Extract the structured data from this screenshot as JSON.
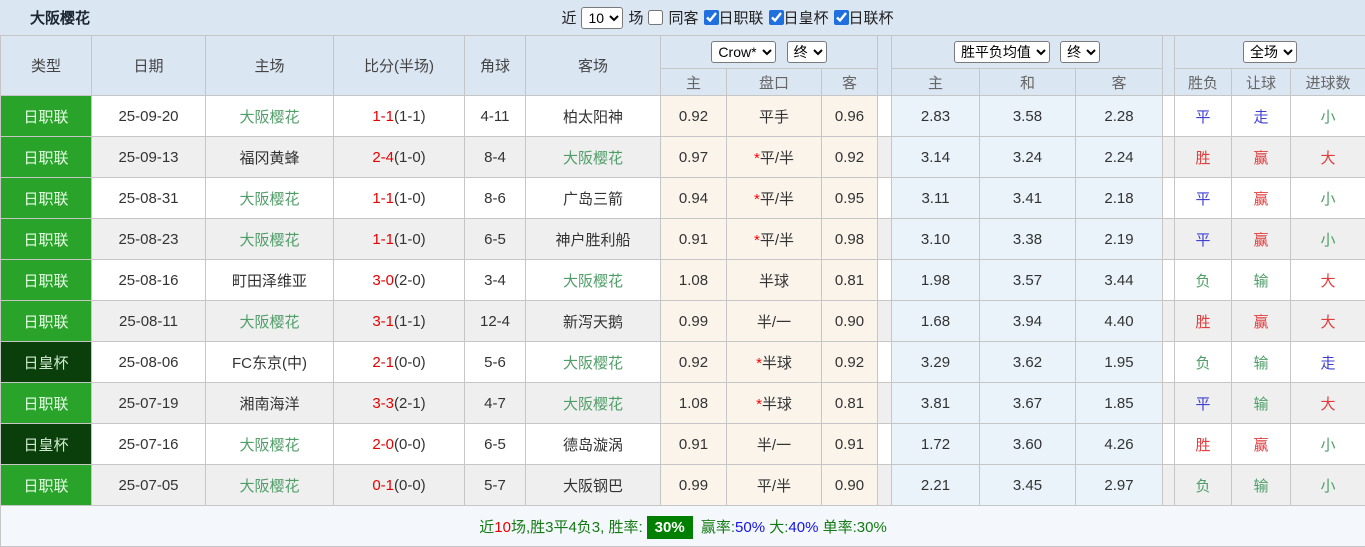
{
  "topbar": {
    "title": "大阪樱花",
    "recent_label": "近",
    "recent_value": "10",
    "matches_label": "场",
    "same_away_label": "同客",
    "same_away_checked": false,
    "filters": [
      {
        "label": "日职联",
        "checked": true
      },
      {
        "label": "日皇杯",
        "checked": true
      },
      {
        "label": "日联杯",
        "checked": true
      }
    ]
  },
  "header": {
    "col_type": "类型",
    "col_date": "日期",
    "col_home": "主场",
    "col_score": "比分(半场)",
    "col_corner": "角球",
    "col_away": "客场",
    "odds_company": "Crow*",
    "odds_state": "终",
    "avg_type": "胜平负均值",
    "avg_state": "终",
    "scope": "全场",
    "sub": {
      "home": "主",
      "handicap": "盘口",
      "away": "客",
      "avg_home": "主",
      "avg_draw": "和",
      "avg_away": "客",
      "result": "胜负",
      "handicap_result": "让球",
      "goals": "进球数"
    }
  },
  "rows": [
    {
      "league": {
        "text": "日职联",
        "c": "j1"
      },
      "date": "25-09-20",
      "home": {
        "text": "大阪樱花",
        "c": "green"
      },
      "score": {
        "ft": "1-1",
        "ht": "(1-1)"
      },
      "corner": "4-11",
      "away": {
        "text": "柏太阳神",
        "c": "dark"
      },
      "odds_home": "0.92",
      "handicap": {
        "star": false,
        "text": "平手"
      },
      "odds_away": "0.96",
      "avg_home": "2.83",
      "avg_draw": "3.58",
      "avg_away": "2.28",
      "result": {
        "text": "平",
        "c": "blue"
      },
      "hresult": {
        "text": "走",
        "c": "blue"
      },
      "goals": {
        "text": "小",
        "c": "green"
      }
    },
    {
      "league": {
        "text": "日职联",
        "c": "j1"
      },
      "date": "25-09-13",
      "home": {
        "text": "福冈黄蜂",
        "c": "dark"
      },
      "score": {
        "ft": "2-4",
        "ht": "(1-0)"
      },
      "corner": "8-4",
      "away": {
        "text": "大阪樱花",
        "c": "green"
      },
      "odds_home": "0.97",
      "handicap": {
        "star": true,
        "text": "平/半"
      },
      "odds_away": "0.92",
      "avg_home": "3.14",
      "avg_draw": "3.24",
      "avg_away": "2.24",
      "result": {
        "text": "胜",
        "c": "red"
      },
      "hresult": {
        "text": "赢",
        "c": "red"
      },
      "goals": {
        "text": "大",
        "c": "red"
      }
    },
    {
      "league": {
        "text": "日职联",
        "c": "j1"
      },
      "date": "25-08-31",
      "home": {
        "text": "大阪樱花",
        "c": "green"
      },
      "score": {
        "ft": "1-1",
        "ht": "(1-0)"
      },
      "corner": "8-6",
      "away": {
        "text": "广岛三箭",
        "c": "dark"
      },
      "odds_home": "0.94",
      "handicap": {
        "star": true,
        "text": "平/半"
      },
      "odds_away": "0.95",
      "avg_home": "3.11",
      "avg_draw": "3.41",
      "avg_away": "2.18",
      "result": {
        "text": "平",
        "c": "blue"
      },
      "hresult": {
        "text": "赢",
        "c": "red"
      },
      "goals": {
        "text": "小",
        "c": "green"
      }
    },
    {
      "league": {
        "text": "日职联",
        "c": "j1"
      },
      "date": "25-08-23",
      "home": {
        "text": "大阪樱花",
        "c": "green"
      },
      "score": {
        "ft": "1-1",
        "ht": "(1-0)"
      },
      "corner": "6-5",
      "away": {
        "text": "神户胜利船",
        "c": "dark"
      },
      "odds_home": "0.91",
      "handicap": {
        "star": true,
        "text": "平/半"
      },
      "odds_away": "0.98",
      "avg_home": "3.10",
      "avg_draw": "3.38",
      "avg_away": "2.19",
      "result": {
        "text": "平",
        "c": "blue"
      },
      "hresult": {
        "text": "赢",
        "c": "red"
      },
      "goals": {
        "text": "小",
        "c": "green"
      }
    },
    {
      "league": {
        "text": "日职联",
        "c": "j1"
      },
      "date": "25-08-16",
      "home": {
        "text": "町田泽维亚",
        "c": "dark"
      },
      "score": {
        "ft": "3-0",
        "ht": "(2-0)"
      },
      "corner": "3-4",
      "away": {
        "text": "大阪樱花",
        "c": "green"
      },
      "odds_home": "1.08",
      "handicap": {
        "star": false,
        "text": "半球"
      },
      "odds_away": "0.81",
      "avg_home": "1.98",
      "avg_draw": "3.57",
      "avg_away": "3.44",
      "result": {
        "text": "负",
        "c": "green"
      },
      "hresult": {
        "text": "输",
        "c": "green"
      },
      "goals": {
        "text": "大",
        "c": "red"
      }
    },
    {
      "league": {
        "text": "日职联",
        "c": "j1"
      },
      "date": "25-08-11",
      "home": {
        "text": "大阪樱花",
        "c": "green"
      },
      "score": {
        "ft": "3-1",
        "ht": "(1-1)"
      },
      "corner": "12-4",
      "away": {
        "text": "新泻天鹅",
        "c": "dark"
      },
      "odds_home": "0.99",
      "handicap": {
        "star": false,
        "text": "半/一"
      },
      "odds_away": "0.90",
      "avg_home": "1.68",
      "avg_draw": "3.94",
      "avg_away": "4.40",
      "result": {
        "text": "胜",
        "c": "red"
      },
      "hresult": {
        "text": "赢",
        "c": "red"
      },
      "goals": {
        "text": "大",
        "c": "red"
      }
    },
    {
      "league": {
        "text": "日皇杯",
        "c": "cup"
      },
      "date": "25-08-06",
      "home": {
        "text": "FC东京(中)",
        "c": "dark"
      },
      "score": {
        "ft": "2-1",
        "ht": "(0-0)"
      },
      "corner": "5-6",
      "away": {
        "text": "大阪樱花",
        "c": "green"
      },
      "odds_home": "0.92",
      "handicap": {
        "star": true,
        "text": "半球"
      },
      "odds_away": "0.92",
      "avg_home": "3.29",
      "avg_draw": "3.62",
      "avg_away": "1.95",
      "result": {
        "text": "负",
        "c": "green"
      },
      "hresult": {
        "text": "输",
        "c": "green"
      },
      "goals": {
        "text": "走",
        "c": "blue"
      }
    },
    {
      "league": {
        "text": "日职联",
        "c": "j1"
      },
      "date": "25-07-19",
      "home": {
        "text": "湘南海洋",
        "c": "dark"
      },
      "score": {
        "ft": "3-3",
        "ht": "(2-1)"
      },
      "corner": "4-7",
      "away": {
        "text": "大阪樱花",
        "c": "green"
      },
      "odds_home": "1.08",
      "handicap": {
        "star": true,
        "text": "半球"
      },
      "odds_away": "0.81",
      "avg_home": "3.81",
      "avg_draw": "3.67",
      "avg_away": "1.85",
      "result": {
        "text": "平",
        "c": "blue"
      },
      "hresult": {
        "text": "输",
        "c": "green"
      },
      "goals": {
        "text": "大",
        "c": "red"
      }
    },
    {
      "league": {
        "text": "日皇杯",
        "c": "cup"
      },
      "date": "25-07-16",
      "home": {
        "text": "大阪樱花",
        "c": "green"
      },
      "score": {
        "ft": "2-0",
        "ht": "(0-0)"
      },
      "corner": "6-5",
      "away": {
        "text": "德岛漩涡",
        "c": "dark"
      },
      "odds_home": "0.91",
      "handicap": {
        "star": false,
        "text": "半/一"
      },
      "odds_away": "0.91",
      "avg_home": "1.72",
      "avg_draw": "3.60",
      "avg_away": "4.26",
      "result": {
        "text": "胜",
        "c": "red"
      },
      "hresult": {
        "text": "赢",
        "c": "red"
      },
      "goals": {
        "text": "小",
        "c": "green"
      }
    },
    {
      "league": {
        "text": "日职联",
        "c": "j1"
      },
      "date": "25-07-05",
      "home": {
        "text": "大阪樱花",
        "c": "green"
      },
      "score": {
        "ft": "0-1",
        "ht": "(0-0)"
      },
      "corner": "5-7",
      "away": {
        "text": "大阪钢巴",
        "c": "dark"
      },
      "odds_home": "0.99",
      "handicap": {
        "star": false,
        "text": "平/半"
      },
      "odds_away": "0.90",
      "avg_home": "2.21",
      "avg_draw": "3.45",
      "avg_away": "2.97",
      "result": {
        "text": "负",
        "c": "green"
      },
      "hresult": {
        "text": "输",
        "c": "green"
      },
      "goals": {
        "text": "小",
        "c": "green"
      }
    }
  ],
  "summary": {
    "prefix": "近",
    "count": "10",
    "mid": "场,胜3平4负3, 胜率:",
    "win_rate": "30%",
    "lbl_win": "赢率:",
    "val_win": "50%",
    "lbl_big": "大:",
    "val_big": "40%",
    "lbl_single": "单率:",
    "val_single": "30%"
  },
  "colors": {
    "league_j1_bg": "#2aa32a",
    "league_cup_bg": "#0a3e0a",
    "header_bg": "#dbe6f3",
    "crow_col_bg": "#faf4eb",
    "avg_col_bg": "#e9f3f9",
    "win_red": "#e23b3b",
    "draw_blue": "#3f3fd4",
    "lose_green": "#4f9e68",
    "score_red": "#e60000",
    "rate_badge_bg": "#008000"
  }
}
